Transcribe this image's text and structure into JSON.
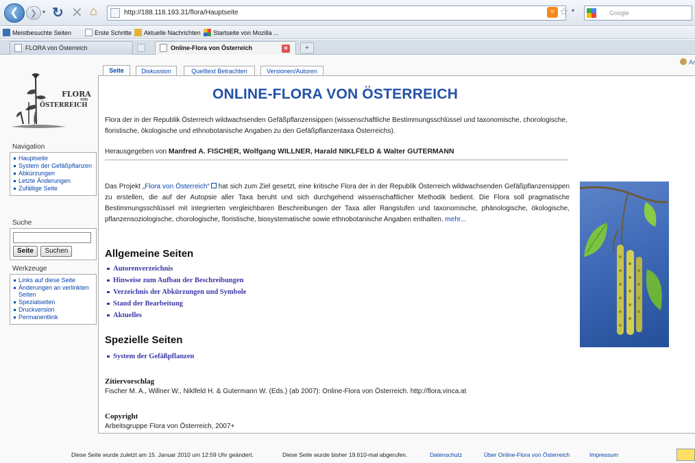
{
  "browser": {
    "url": "http://188.118.193.31/flora/Hauptseite",
    "search_placeholder": "Google",
    "bookmarks": [
      "Meistbesuchte Seiten",
      "Erste Schritte",
      "Aktuelle Nachrichten",
      "Startseite von Mozilla ..."
    ],
    "tabs": [
      {
        "label": "FLORA von Österreich"
      },
      {
        "label": "Online-Flora von Österreich"
      }
    ]
  },
  "userbar": {
    "label": "Ar"
  },
  "logo": {
    "line1": "FLORA",
    "line2": "VON",
    "line3": "ÖSTERREICH"
  },
  "sidebar": {
    "navigation": {
      "title": "Navigation",
      "items": [
        "Hauptseite",
        "System der Gefäßpflanzen",
        "Abkürzungen",
        "Letzte Änderungen",
        "Zufällige Seite"
      ]
    },
    "search": {
      "title": "Suche",
      "go_label": "Seite",
      "search_label": "Suchen"
    },
    "tools": {
      "title": "Werkzeuge",
      "items": [
        "Links auf diese Seite",
        "Änderungen an verlinkten Seiten",
        "Spezialseiten",
        "Druckversion",
        "Permanentlink"
      ]
    }
  },
  "page_tabs": [
    "Seite",
    "Diskussion",
    "Quelltext Betrachten",
    "Versionen/Autoren"
  ],
  "main": {
    "title": "ONLINE-FLORA VON ÖSTERREICH",
    "intro": "Flora der in der Republik Österreich wildwachsenden Gefäßpflanzensippen (wissenschaftliche Bestimmungsschlüssel und taxonomische, chorologische, floristische, ökologische und ethnobotanische Angaben zu den Gefäßpflanzentaxa Österreichs).",
    "editors_prefix": "Herausgegeben von",
    "editors": "Manfred A. FISCHER, Wolfgang WILLNER, Harald NIKLFELD & Walter GUTERMANN",
    "project_before": "Das Projekt",
    "project_link": "„Flora von Österreich“",
    "project_after": "hat sich zum Ziel gesetzt, eine kritische Flora der in der Republik Österreich wildwachsenden Gefäßpflanzensippen zu erstellen, die auf der Autopsie aller Taxa beruht und sich durchgehend wissenschaftlicher Methodik bedient. Die Flora soll pragmatische Bestimmungsschlüssel mit integrierten vergleichbaren Beschreibungen der Taxa aller Rangstufen und taxonomische, phänologische, ökologische, pflanzensoziologische, chorologische, floristische, biosystematische sowie ethnobotanische Angaben enthalten.",
    "more": "mehr...",
    "section1": "Allgemeine Seiten",
    "section1_links": [
      "Autorenverzeichnis",
      "Hinweise zum Aufbau der Beschreibungen",
      "Verzeichnis der Abkürzungen und Symbole",
      "Stand der Bearbeitung",
      "Aktuelles"
    ],
    "section2": "Spezielle Seiten",
    "section2_links": [
      "System der Gefäßpflanzen"
    ],
    "citation_title": "Zitiervorschlag",
    "citation": "Fischer M. A., Willner W., Niklfeld H. & Gutermann W. (Eds.) (ab 2007): Online-Flora von Österreich. http://flora.vinca.at",
    "copyright_title": "Copyright",
    "copyright": "Arbeitsgruppe Flora von Österreich, 2007+"
  },
  "footer": {
    "last_modified": "Diese Seite wurde zuletzt am 15. Januar 2010 um 12:59 Uhr geändert.",
    "views": "Diese Seite wurde bisher 19.610-mal abgerufen.",
    "links": [
      "Datenschutz",
      "Über Online-Flora von Österreich",
      "Impressum"
    ]
  },
  "colors": {
    "link": "#0645ad",
    "title": "#2451a6",
    "section_link": "#3b37a6"
  }
}
